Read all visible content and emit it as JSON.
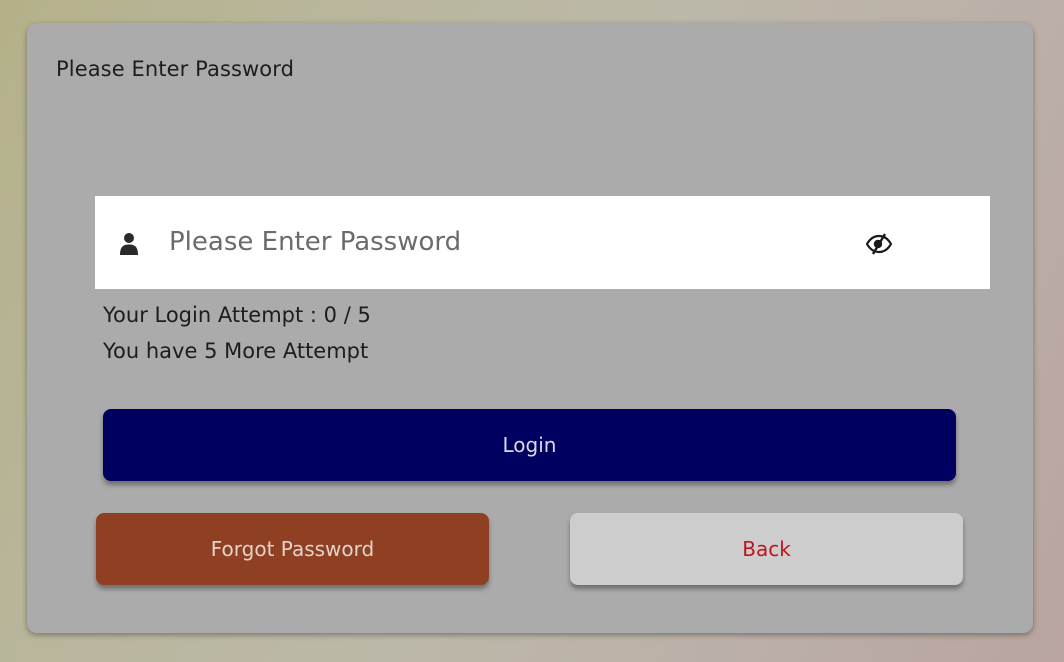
{
  "card": {
    "title": "Please Enter Password"
  },
  "password_field": {
    "placeholder": "Please Enter Password",
    "value": "",
    "leading_icon": "user-icon",
    "trailing_icon": "eye-slash-icon"
  },
  "attempts": {
    "line1": "Your Login Attempt : 0 / 5",
    "line2": "You have 5 More Attempt"
  },
  "buttons": {
    "login": "Login",
    "forgot": "Forgot Password",
    "back": "Back"
  },
  "colors": {
    "login_bg": "#000061",
    "forgot_bg": "#8f4022",
    "back_bg": "#cdcdcd",
    "back_text": "#c0121f"
  }
}
